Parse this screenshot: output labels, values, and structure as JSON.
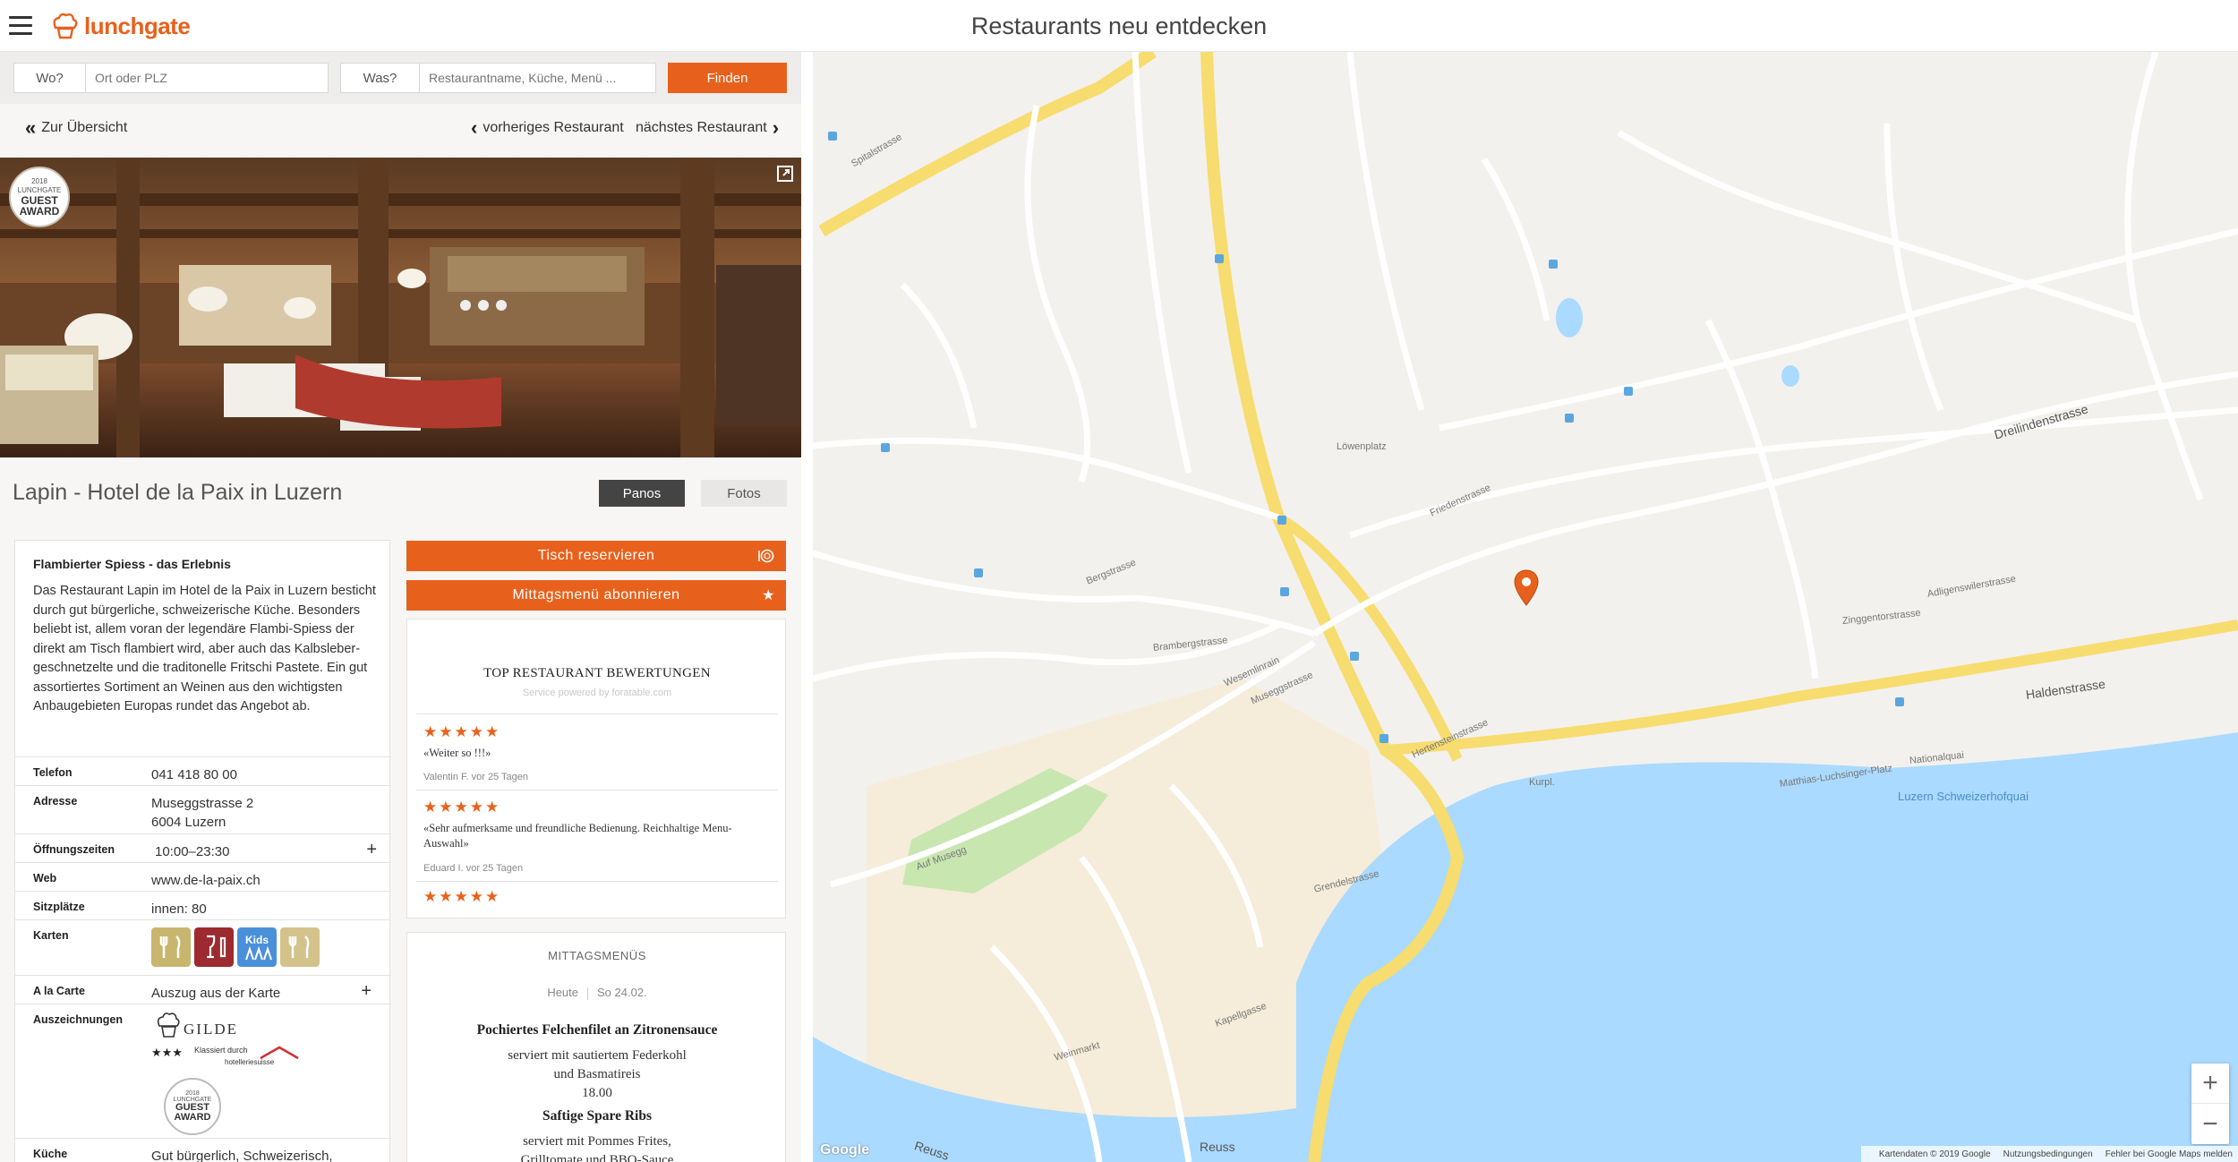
{
  "header": {
    "brand": "lunchgate",
    "title": "Restaurants neu entdecken"
  },
  "search": {
    "where_label": "Wo?",
    "where_placeholder": "Ort oder PLZ",
    "what_label": "Was?",
    "what_placeholder": "Restaurantname, Küche, Menü ...",
    "button": "Finden"
  },
  "nav": {
    "back": "Zur Übersicht",
    "prev": "vorheriges Restaurant",
    "next": "nächstes Restaurant"
  },
  "photo": {
    "badge_top": "LUNCHGATE",
    "badge_main": "GUEST AWARD",
    "badge_year": "2018"
  },
  "restaurant": {
    "title": "Lapin - Hotel de la Paix in Luzern",
    "tabs": [
      "Panos",
      "Fotos"
    ],
    "active_tab": "Panos",
    "headline": "Flambierter Spiess - das Erlebnis",
    "description": "Das Restaurant Lapin im Hotel de la Paix in Luzern besticht durch gut bürgerliche, schweizerische Küche. Besonders beliebt ist, allem voran der legendäre Flambi-Spiess der direkt am Tisch flambiert wird, aber auch das Kalbsleber­geschnetzelte und die traditonelle Fritschi Pastete. Ein gut assortiertes Sortiment an Weinen aus den wichtigsten Anbaugebieten Europas rundet das Angebot ab.",
    "info": {
      "phone_label": "Telefon",
      "phone": "041 418 80 00",
      "address_label": "Adresse",
      "address_line1": "Museggstrasse 2",
      "address_line2": "6004 Luzern",
      "hours_label": "Öffnungszeiten",
      "hours": "10:00–23:30",
      "web_label": "Web",
      "web": "www.de-la-paix.ch",
      "seats_label": "Sitzplätze",
      "seats": "innen: 80",
      "cards_label": "Karten",
      "alacarte_label": "A la Carte",
      "alacarte": "Auszug aus der Karte",
      "awards_label": "Auszeichnungen",
      "award_gilde": "GILDE",
      "award_class_1": "Klassiert durch",
      "award_class_2": "hotelleriesuisse",
      "award_stars": "★★★",
      "cuisine_label": "Küche",
      "cuisine": "Gut bürgerlich, Schweizerisch,"
    }
  },
  "actions": {
    "reserve": "Tisch reservieren",
    "subscribe": "Mittagsmenü abonnieren"
  },
  "reviews": {
    "title": "TOP RESTAURANT BEWERTUNGEN",
    "powered": "Service powered by foratable.com",
    "items": [
      {
        "stars": "★★★★★",
        "quote": "«Weiter so !!!»",
        "author": "Valentin F. vor 25 Tagen"
      },
      {
        "stars": "★★★★★",
        "quote": "«Sehr aufmerksame und freundliche Bedienung. Reichhaltige Menu-Auswahl»",
        "author": "Eduard I. vor 25 Tagen"
      },
      {
        "stars": "★★★★★"
      }
    ]
  },
  "lunch": {
    "title": "MITTAGSMENÜS",
    "day": "Heute",
    "date": "So 24.02.",
    "dish1_name": "Pochiertes Felchenfilet an Zitronensauce",
    "dish1_line1": "serviert mit sautiertem Federkohl",
    "dish1_line2": "und Basmatireis",
    "dish1_price": "18.00",
    "dish2_name": "Saftige Spare Ribs",
    "dish2_line1": "serviert mit Pommes Frites,",
    "dish2_line2": "Grilltomate und BBQ-Sauce"
  },
  "map": {
    "labels": {
      "spitalstrasse": "Spitalstrasse",
      "haldenstrasse": "Haldenstrasse",
      "dreilinden": "Dreilindenstrasse",
      "museggstrasse": "Museggstrasse",
      "hertenstein": "Hertensteinstrasse",
      "schweizerhof": "Luzern Schweizerhofquai",
      "reuss": "Reuss",
      "nationalquai": "Nationalquai",
      "luchsinger": "Matthias-Luchsinger-Platz",
      "weinmarkt": "Weinmarkt",
      "kapellgasse": "Kapellgasse",
      "grendel": "Grendelstrasse",
      "bergstrasse": "Bergstrasse",
      "brambergstrasse": "Brambergstrasse",
      "wesemlin": "Wesemlinrain",
      "loewenplatz": "Löwenplatz",
      "kurplatz": "Kurpl.",
      "friedenstrasse": "Friedenstrasse",
      "adligenswil": "Adligenswilerstrasse",
      "zinggentor": "Zinggentorstrasse",
      "auf_musegg": "Auf Musegg"
    },
    "zoom_in": "+",
    "zoom_out": "−",
    "footer_data": "Kartendaten © 2019 Google",
    "footer_terms": "Nutzungsbedingungen",
    "footer_report": "Fehler bei Google Maps melden",
    "watermark": "Google",
    "colors": {
      "water": "#aadaff",
      "park": "#c8e6b0",
      "road_main": "#f7dc6f",
      "pin": "#e8611c"
    }
  }
}
